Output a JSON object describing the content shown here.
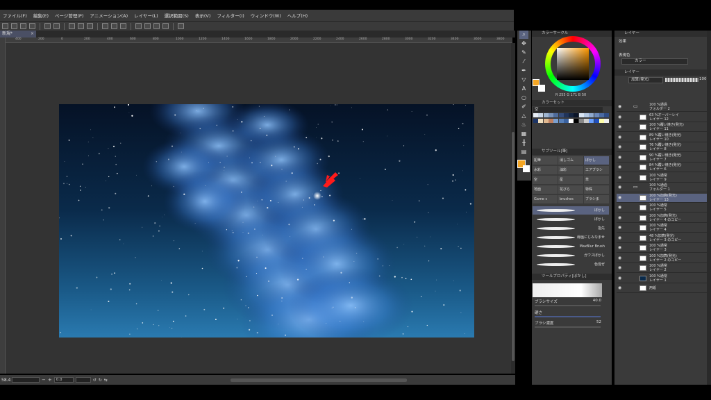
{
  "menu": [
    "ファイル(F)",
    "編集(E)",
    "ページ管理(P)",
    "アニメーション(A)",
    "レイヤー(L)",
    "選択範囲(S)",
    "表示(V)",
    "フィルター(I)",
    "ウィンドウ(W)",
    "ヘルプ(H)"
  ],
  "document_tab": {
    "label": "新規*",
    "close": "×"
  },
  "ruler_ticks": [
    "400",
    "200",
    "0",
    "200",
    "400",
    "600",
    "800",
    "1000",
    "1200",
    "1400",
    "1600",
    "1800",
    "2000",
    "2200",
    "2400",
    "2600",
    "2800",
    "3000",
    "3200",
    "3400",
    "3600",
    "3800"
  ],
  "statusbar": {
    "zoom": "58.4",
    "angle": "0.0"
  },
  "color_circle": {
    "header": "カラーサークル",
    "rgb_text": "R 255  G 171  B 50"
  },
  "color_set": {
    "header": "カラーセット",
    "set_name": "空"
  },
  "subtool": {
    "header": "サブツール[筆]",
    "buttons": [
      "鉛筆",
      "消しゴム",
      "ぼかし",
      "水彩",
      "油彩",
      "エアブラシ",
      "空",
      "星",
      "草",
      "地面",
      "花びら",
      "特殊",
      "Game c",
      "brushes",
      "ブラシま"
    ]
  },
  "brushes": [
    "ぼかし",
    "ぼかし",
    "指先",
    "線画にじみなませ",
    "MaxBlur Brush",
    "ガウスぼかし",
    "色混ぜ"
  ],
  "tool_property": {
    "header": "ツールプロパティ[ぼかし]",
    "brush_size_label": "ブラシサイズ",
    "brush_size": "40.0",
    "angle_label": "硬さ",
    "density_label": "ブラシ濃度",
    "density": "52"
  },
  "layer_property": {
    "header": "レイヤー",
    "effect_label": "効果",
    "expression_label": "表現色",
    "expression_value": "カラー"
  },
  "layer_panel": {
    "header": "レイヤー",
    "blend_mode": "加算(発光)",
    "opacity": "100"
  },
  "layers": [
    {
      "l1": "100 %通過",
      "l2": "フォルダー 2",
      "type": "folder"
    },
    {
      "l1": "63 %オーバーレイ",
      "l2": "レイヤー 12",
      "type": "layer"
    },
    {
      "l1": "100 %覆い焼き(発光)",
      "l2": "レイヤー 11",
      "type": "layer"
    },
    {
      "l1": "89 %覆い焼き(発光)",
      "l2": "レイヤー 10",
      "type": "layer"
    },
    {
      "l1": "76 %覆い焼き(発光)",
      "l2": "レイヤー 8",
      "type": "layer"
    },
    {
      "l1": "90 %覆い焼き(発光)",
      "l2": "レイヤー 7",
      "type": "layer"
    },
    {
      "l1": "84 %覆い焼き(発光)",
      "l2": "レイヤー 6",
      "type": "layer"
    },
    {
      "l1": "100 %通常",
      "l2": "レイヤー 9",
      "type": "layer"
    },
    {
      "l1": "100 %通過",
      "l2": "フォルダー 1",
      "type": "folder"
    },
    {
      "l1": "100 %加算(発光)",
      "l2": "レイヤー 13",
      "type": "layer",
      "sel": true
    },
    {
      "l1": "100 %通常",
      "l2": "レイヤー 5",
      "type": "layer"
    },
    {
      "l1": "100 %加算(発光)",
      "l2": "レイヤー 4 のコピー",
      "type": "layer"
    },
    {
      "l1": "100 %通常",
      "l2": "レイヤー 4",
      "type": "layer"
    },
    {
      "l1": "48 %加算(発光)",
      "l2": "レイヤー 3 のコピー",
      "type": "layer"
    },
    {
      "l1": "100 %通常",
      "l2": "レイヤー 3",
      "type": "layer"
    },
    {
      "l1": "100 %加算(発光)",
      "l2": "レイヤー 2 のコピー",
      "type": "layer"
    },
    {
      "l1": "100 %通常",
      "l2": "レイヤー 2",
      "type": "layer"
    },
    {
      "l1": "100 %通常",
      "l2": "レイヤー 1",
      "type": "layer"
    },
    {
      "l1": "",
      "l2": "用紙",
      "type": "paper"
    }
  ],
  "colors": {
    "foreground": "#f5a623",
    "background": "#ffffff",
    "accent_selection": "#5a6380",
    "marker": "#ff1a1a"
  }
}
